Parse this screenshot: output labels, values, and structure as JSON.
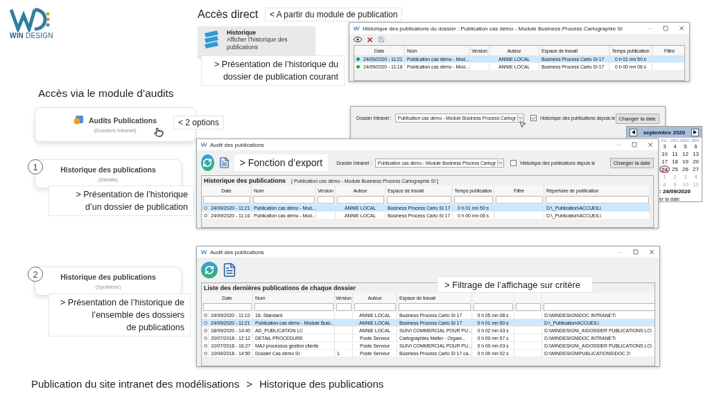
{
  "logo": {
    "strong": "WIN",
    "rest": "DESIGN"
  },
  "direct_access": {
    "heading": "Accès direct",
    "note": "< A partir du module de publication",
    "ribbon_button": {
      "title": "Historique",
      "subtitle": "Afficher l'historique des publications"
    },
    "callout_lines": [
      "> Présentation de l’historique du",
      "dossier de publication courant"
    ]
  },
  "history_window": {
    "title": "Historique des publications du dossier : Publication cas démo - Module Business Process Cartographie SI",
    "columns": [
      "Date",
      "Nom",
      "Version",
      "Auteur",
      "Espace de travail",
      "Temps publication",
      "Filtre"
    ],
    "rows": [
      {
        "selected": true,
        "cells": [
          "24/09/2020 - 11:21",
          "Publication cas démo - Mod...",
          null,
          "ANNIE LOCAL",
          "Business Process Carto SI 17",
          "0 h 01 mn 50 s",
          null
        ]
      },
      {
        "selected": false,
        "cells": [
          "24/09/2020 - 11:16",
          "Publication cas démo - Mod...",
          null,
          "ANNIE LOCAL",
          "Business Process Carto SI 17",
          "0 h 00 mn 06 s",
          null
        ]
      }
    ]
  },
  "audits_heading": "Accès via le module d’audits",
  "audits_card": {
    "title": "Audits Publications",
    "subtitle": "(Dossiers Intranet)"
  },
  "options_note": "< 2 options",
  "background_window": {
    "folder_label": "Dossier Intranet :",
    "folder_value": "Publication cas démo - Module Business Process Cartogr",
    "history_since_checked": true,
    "history_since_label": "Historique des publications depuis le",
    "change_date_button": "Changer la date"
  },
  "calendar": {
    "month": "septembre 2020",
    "day_names": [
      "eu.",
      "ven.",
      "sam.",
      "dim."
    ],
    "weeks": [
      [
        {
          "label": "3",
          "selected": false,
          "other_month": false
        },
        {
          "label": "4",
          "selected": false,
          "other_month": false
        },
        {
          "label": "5",
          "selected": false,
          "other_month": false
        },
        {
          "label": "6",
          "selected": false,
          "other_month": false
        }
      ],
      [
        {
          "label": "10",
          "selected": false,
          "other_month": false
        },
        {
          "label": "11",
          "selected": false,
          "other_month": false
        },
        {
          "label": "12",
          "selected": false,
          "other_month": false
        },
        {
          "label": "13",
          "selected": false,
          "other_month": false
        }
      ],
      [
        {
          "label": "17",
          "selected": false,
          "other_month": false
        },
        {
          "label": "18",
          "selected": false,
          "other_month": false
        },
        {
          "label": "19",
          "selected": false,
          "other_month": false
        },
        {
          "label": "20",
          "selected": false,
          "other_month": false
        }
      ],
      [
        {
          "label": "24",
          "selected": true,
          "other_month": false
        },
        {
          "label": "25",
          "selected": false,
          "other_month": false
        },
        {
          "label": "26",
          "selected": false,
          "other_month": false
        },
        {
          "label": "27",
          "selected": false,
          "other_month": false
        }
      ],
      [
        {
          "label": "1",
          "selected": false,
          "other_month": true
        },
        {
          "label": "2",
          "selected": false,
          "other_month": true
        },
        {
          "label": "3",
          "selected": false,
          "other_month": true
        },
        {
          "label": "4",
          "selected": false,
          "other_month": true
        }
      ],
      [
        {
          "label": "8",
          "selected": false,
          "other_month": true
        },
        {
          "label": "9",
          "selected": false,
          "other_month": true
        },
        {
          "label": "10",
          "selected": false,
          "other_month": true
        },
        {
          "label": "11",
          "selected": false,
          "other_month": true
        }
      ]
    ],
    "footer_date": ": 24/09/2020",
    "footer_button": "er la date"
  },
  "option_1": {
    "number": "1",
    "title": "Historique des publications",
    "subtitle": "(Détails)",
    "callout_lines": [
      "> Présentation de l’historique",
      "d’un dossier de publication"
    ]
  },
  "details_window": {
    "title": "Audit des publications",
    "export_note": "> Fonction d’export",
    "folder_label": "Dossier Intranet :",
    "folder_value": "Publication cas démo - Module Business Process Cartogr",
    "history_since_checked": false,
    "history_since_label": "Historique des publications depuis le",
    "change_date_button": "Changer la date",
    "group_title": "Historique des publications",
    "group_subtitle": "[ Publication cas démo - Module Business Process Cartographie SI ]",
    "columns": [
      "Date",
      "Nom",
      "Version",
      "Auteur",
      "Espace de travail",
      "Temps publication",
      "Filtre",
      "Répertoire de publication"
    ],
    "rows": [
      {
        "selected": true,
        "cells": [
          "24/09/2020 - 11:21",
          "Publication cas démo - Mod...",
          null,
          "ANNIE LOCAL",
          "Business Process Carto SI 17",
          "0 h 01 mn 50 s",
          null,
          "D:\\_Publication\\ACCUEIL\\"
        ]
      },
      {
        "selected": false,
        "cells": [
          "24/09/2020 - 11:16",
          "Publication cas démo - Mod...",
          null,
          "ANNIE LOCAL",
          "Business Process Carto SI 17",
          "0 h 00 mn 06 s",
          null,
          "D:\\_Publication\\ACCUEIL\\"
        ]
      }
    ]
  },
  "option_2": {
    "number": "2",
    "title": "Historique des publications",
    "subtitle": "(Synthèse)",
    "callout_lines": [
      "> Présentation de l’historique de",
      "l’ensemble des dossiers",
      "de publications"
    ]
  },
  "summary_window": {
    "title": "Audit des publications",
    "group_title": "Liste des dernières publications de chaque dossier",
    "filter_note": "> Filtrage de l’affichage  sur critère",
    "columns": [
      "Date",
      "Nom",
      "Version",
      "Auteur",
      "Espace de travail",
      null,
      null,
      null
    ],
    "rows": [
      {
        "selected": false,
        "cells": [
          "24/09/2020 - 11:10",
          "16- Standard",
          null,
          "ANNIE LOCAL",
          "Business Process Carto SI 17",
          "0 h 05 mn 08 s",
          null,
          "D:\\WINDESIGN\\DOC INTRANET\\"
        ]
      },
      {
        "selected": true,
        "cells": [
          "24/09/2020 - 11:21",
          "Publication cas démo - Module Busi...",
          null,
          "ANNIE LOCAL",
          "Business Process Carto SI 17",
          "0 h 01 mn 50 s",
          null,
          "D:\\_Publication\\ACCUEIL\\"
        ]
      },
      {
        "selected": false,
        "cells": [
          "18/09/2020 - 14:40",
          "AD_PUBLICATION LC",
          null,
          "ANNIE LOCAL",
          "SUIVI COMMERCIAL POUR PU...",
          "0 h 02 mn 43 s",
          null,
          "D:\\WINDESIGN\\_A\\DOSSIER PUBLICATIONS LC\\"
        ]
      },
      {
        "selected": false,
        "cells": [
          "20/07/2018 - 12:12",
          "DETAIL PROCEDURE",
          null,
          "Poste Serveur",
          "Cartographies Metier - Organi...",
          "0 h 00 mn 57 s",
          null,
          "D:\\WINDESIGN\\DOC INTRANET\\"
        ]
      },
      {
        "selected": false,
        "cells": [
          "10/07/2018 - 16:27",
          "MAJ  processus gestion clients",
          null,
          "Poste Serveur",
          "SUIVI COMMERCIAL POUR PU...",
          "0 h 00 mn 03 s",
          null,
          "D:\\WINDESIGN\\_A\\DOSSIER PUBLICATIONS LC\\"
        ]
      },
      {
        "selected": false,
        "cells": [
          "10/04/2018 - 14:50",
          "Dossier Cas démo SI",
          "1",
          "Poste Serveur",
          "Business Process Carto SI 17 ca...",
          "0 h 00 mn 02 s",
          null,
          "D:\\WINDESIGN\\PUBLICATIONS\\DOC 2\\"
        ]
      }
    ]
  },
  "footer": {
    "path": "Publication du site intranet des modélisations",
    "separator": ">",
    "page": "Historique des publications"
  }
}
